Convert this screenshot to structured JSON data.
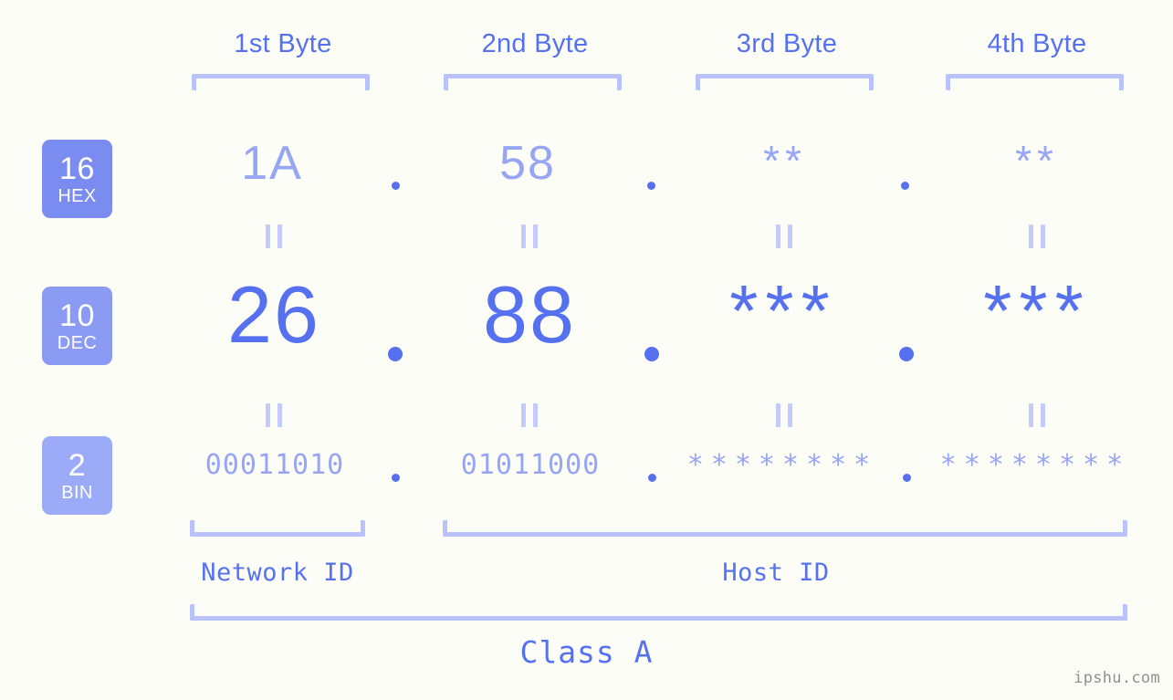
{
  "meta": {
    "background": "#fcfdf7",
    "accent_dark": "#5671f0",
    "accent_light": "#97a5f5",
    "bracket": "#b9c2fb"
  },
  "byte_headers": [
    {
      "label": "1st Byte"
    },
    {
      "label": "2nd Byte"
    },
    {
      "label": "3rd Byte"
    },
    {
      "label": "4th Byte"
    }
  ],
  "bases": [
    {
      "num": "16",
      "label": "HEX",
      "color": "#7a8cf0"
    },
    {
      "num": "10",
      "label": "DEC",
      "color": "#8b9bf4"
    },
    {
      "num": "2",
      "label": "BIN",
      "color": "#9cabf7"
    }
  ],
  "rows": {
    "hex": {
      "base_num": "16",
      "base_label": "HEX",
      "values": [
        "1A",
        "58",
        "**",
        "**"
      ],
      "separators": [
        ".",
        ".",
        "."
      ]
    },
    "dec": {
      "base_num": "10",
      "base_label": "DEC",
      "values": [
        "26",
        "88",
        "***",
        "***"
      ],
      "separators": [
        ".",
        ".",
        "."
      ]
    },
    "bin": {
      "base_num": "2",
      "base_label": "BIN",
      "values": [
        "00011010",
        "01011000",
        "********",
        "********"
      ],
      "separators": [
        ".",
        ".",
        "."
      ]
    }
  },
  "equals_marks": {
    "glyph": "||",
    "row1": [
      "||",
      "||",
      "||",
      "||"
    ],
    "row2": [
      "||",
      "||",
      "||",
      "||"
    ]
  },
  "id_labels": {
    "network": "Network ID",
    "host": "Host ID"
  },
  "class_label": "Class A",
  "watermark": "ipshu.com"
}
